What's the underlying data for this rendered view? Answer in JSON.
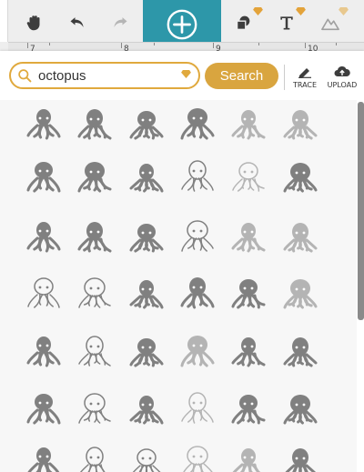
{
  "toolbar": {
    "tools": [
      {
        "name": "hand-tool",
        "icon": "hand-icon"
      },
      {
        "name": "undo",
        "icon": "undo-icon"
      },
      {
        "name": "redo",
        "icon": "redo-icon"
      },
      {
        "name": "add",
        "icon": "plus-circle-icon"
      },
      {
        "name": "shapes",
        "icon": "shapes-icon",
        "premium": true
      },
      {
        "name": "text",
        "icon": "text-icon",
        "premium": true
      },
      {
        "name": "image",
        "icon": "image-icon",
        "premium": true
      }
    ],
    "ruler_numbers": [
      "7",
      "8",
      "9",
      "10"
    ]
  },
  "search": {
    "value": "octopus",
    "button_label": "Search"
  },
  "actions": {
    "trace_label": "TRACE",
    "upload_label": "UPLOAD"
  },
  "colors": {
    "accent": "#2d97a9",
    "gold": "#d9a53f",
    "icon_gray": "#808080",
    "icon_light": "#b4b4b4"
  },
  "results": [
    [
      "octopus-solid",
      "squid-sketch",
      "octopus-cartoon-face",
      "octopus-round-head",
      "octopus-swirl",
      "octopus-tentacle-curl"
    ],
    [
      "octopus-flat-small",
      "octopus-long-legs",
      "octopus-star-tentacles",
      "octopus-outline-round",
      "octopus-ghost-outline",
      "octopus-swimming"
    ],
    [
      "octopus-compact",
      "octopus-curly",
      "octopus-mermaid",
      "octopus-bubbles-cute",
      "octopus-faint-outline",
      "octopus-faint-small"
    ],
    [
      "octopus-line-small",
      "octopus-circles",
      "squid-simple",
      "octopus-tall",
      "octopus-blob",
      "octopus-faint-curly"
    ],
    [
      "octopus-hook",
      "octopus-spotted",
      "octopus-big-eyes",
      "octopus-tiny-faint",
      "octopus-rings",
      "octopus-patterned"
    ],
    [
      "octopus-robot",
      "octopus-screaming",
      "squid-vertical",
      "octopus-line-art",
      "octopus-ornate",
      "octopus-tribal"
    ],
    [
      "octopus-partial",
      "octopus-wavy",
      "octopus-sketch",
      "octopus-outline-cut",
      "octopus-faint-cut",
      "octopus-clipart-cut"
    ]
  ]
}
